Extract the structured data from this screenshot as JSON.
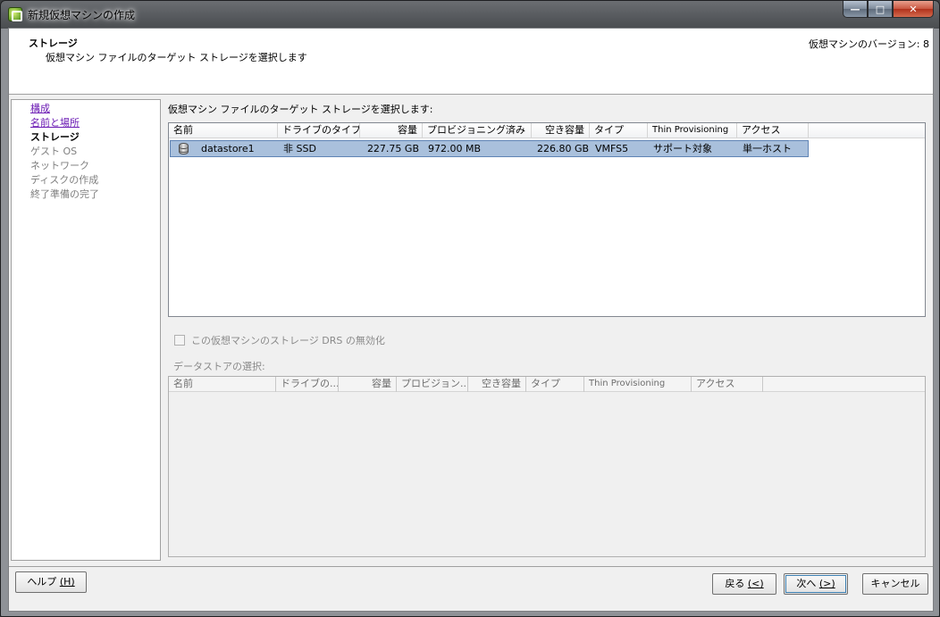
{
  "window": {
    "title": "新規仮想マシンの作成",
    "minimize": "—",
    "maximize": "□",
    "close": "✕"
  },
  "header": {
    "title": "ストレージ",
    "subtitle": "仮想マシン ファイルのターゲット ストレージを選択します",
    "version": "仮想マシンのバージョン: 8"
  },
  "steps": [
    {
      "label": "構成",
      "state": "link"
    },
    {
      "label": "名前と場所",
      "state": "link"
    },
    {
      "label": "ストレージ",
      "state": "current"
    },
    {
      "label": "ゲスト OS",
      "state": "disabled"
    },
    {
      "label": "ネットワーク",
      "state": "disabled"
    },
    {
      "label": "ディスクの作成",
      "state": "disabled"
    },
    {
      "label": "終了準備の完了",
      "state": "disabled"
    }
  ],
  "main": {
    "label": "仮想マシン ファイルのターゲット ストレージを選択します:",
    "storage_table": {
      "columns": [
        "名前",
        "ドライブのタイプ",
        "容量",
        "プロビジョニング済み",
        "空き容量",
        "タイプ",
        "Thin Provisioning",
        "アクセス"
      ],
      "rows": [
        [
          "datastore1",
          "非 SSD",
          "227.75 GB",
          "972.00 MB",
          "226.80 GB",
          "VMFS5",
          "サポート対象",
          "単一ホスト"
        ]
      ]
    },
    "disable_drs_label": "この仮想マシンのストレージ DRS の無効化",
    "datastore_select_label": "データストアの選択:",
    "datastore_table": {
      "columns": [
        "名前",
        "ドライブの...",
        "容量",
        "プロビジョン...",
        "空き容量",
        "タイプ",
        "Thin Provisioning",
        "アクセス"
      ]
    }
  },
  "buttons": {
    "help": "ヘルプ",
    "help_key": "(H)",
    "back": "戻る",
    "back_key": "(<)",
    "next": "次へ",
    "next_key": "(>)",
    "cancel": "キャンセル"
  }
}
